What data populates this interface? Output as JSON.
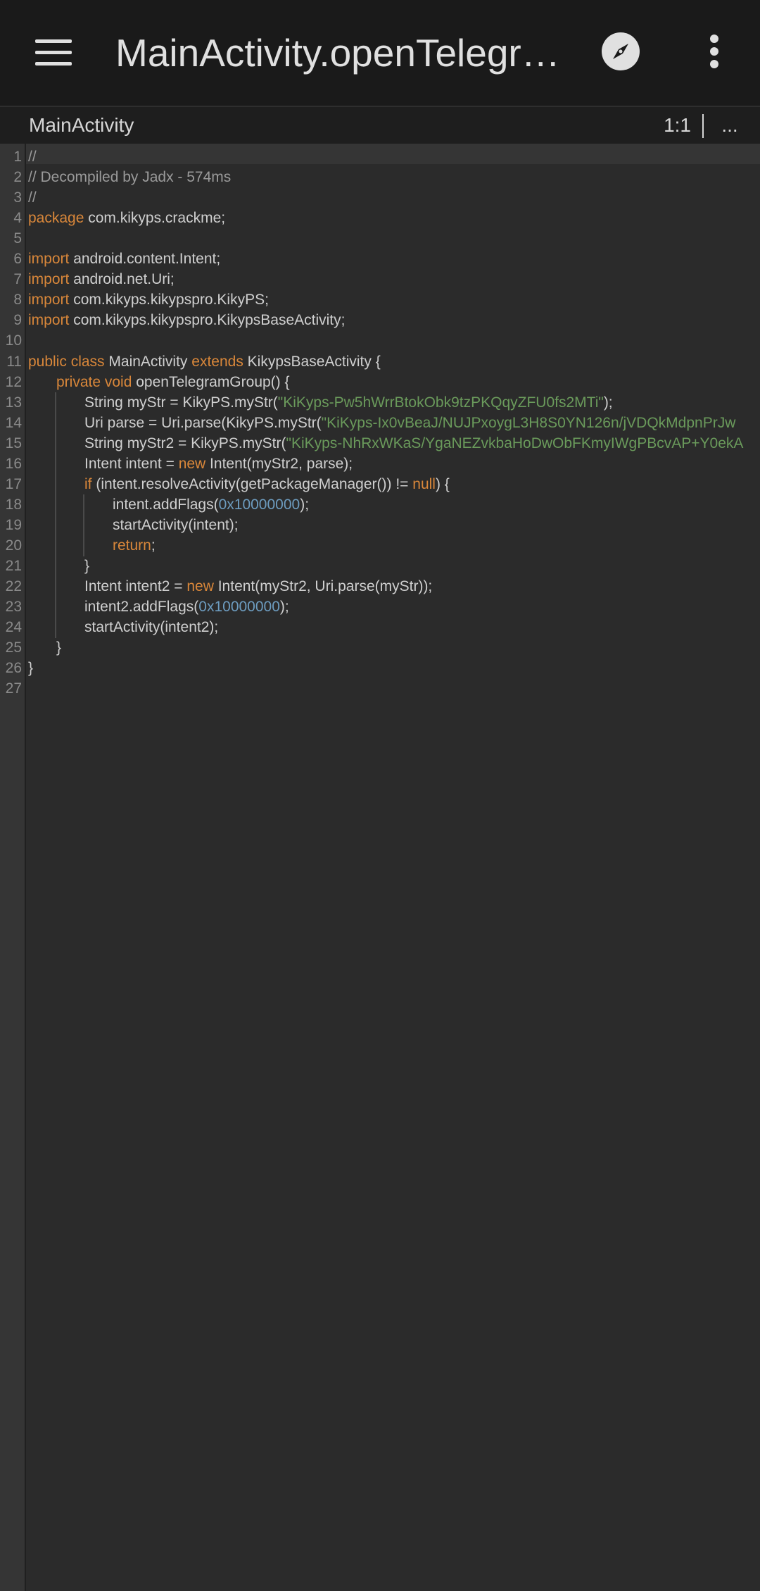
{
  "toolbar": {
    "title": "MainActivity.openTelegr…",
    "menu_icon": "hamburger-menu-icon",
    "compass_icon": "compass-icon",
    "more_icon": "more-vertical-icon"
  },
  "tab_bar": {
    "file_label": "MainActivity",
    "cursor_position": "1:1",
    "more_label": "..."
  },
  "colors": {
    "comment": "#9a9a9a",
    "keyword": "#d9873a",
    "string": "#6a9a5b",
    "number": "#6d9cbf",
    "plain": "#cfcfcf",
    "background": "#2b2b2b",
    "appbar": "#1a1a1a"
  },
  "code": {
    "lines": [
      {
        "n": "1",
        "tokens": [
          {
            "t": "//",
            "c": "comment"
          }
        ]
      },
      {
        "n": "2",
        "tokens": [
          {
            "t": "// Decompiled by Jadx - 574ms",
            "c": "comment"
          }
        ]
      },
      {
        "n": "3",
        "tokens": [
          {
            "t": "//",
            "c": "comment"
          }
        ]
      },
      {
        "n": "4",
        "tokens": [
          {
            "t": "package",
            "c": "keyword"
          },
          {
            "t": " com.kikyps.crackme;",
            "c": "plain"
          }
        ]
      },
      {
        "n": "5",
        "tokens": []
      },
      {
        "n": "6",
        "tokens": [
          {
            "t": "import",
            "c": "keyword"
          },
          {
            "t": " android.content.Intent;",
            "c": "plain"
          }
        ]
      },
      {
        "n": "7",
        "tokens": [
          {
            "t": "import",
            "c": "keyword"
          },
          {
            "t": " android.net.Uri;",
            "c": "plain"
          }
        ]
      },
      {
        "n": "8",
        "tokens": [
          {
            "t": "import",
            "c": "keyword"
          },
          {
            "t": " com.kikyps.kikypspro.KikyPS;",
            "c": "plain"
          }
        ]
      },
      {
        "n": "9",
        "tokens": [
          {
            "t": "import",
            "c": "keyword"
          },
          {
            "t": " com.kikyps.kikypspro.KikypsBaseActivity;",
            "c": "plain"
          }
        ]
      },
      {
        "n": "10",
        "tokens": []
      },
      {
        "n": "11",
        "tokens": [
          {
            "t": "public class",
            "c": "keyword"
          },
          {
            "t": " MainActivity ",
            "c": "plain"
          },
          {
            "t": "extends",
            "c": "keyword"
          },
          {
            "t": " KikypsBaseActivity {",
            "c": "plain"
          }
        ]
      },
      {
        "n": "12",
        "indent": 1,
        "tokens": [
          {
            "t": "private void",
            "c": "keyword"
          },
          {
            "t": " openTelegramGroup() {",
            "c": "plain"
          }
        ]
      },
      {
        "n": "13",
        "indent": 2,
        "tokens": [
          {
            "t": "String myStr = KikyPS.myStr(",
            "c": "plain"
          },
          {
            "t": "\"KiKyps-Pw5hWrrBtokObk9tzPKQqyZFU0fs2MTi\"",
            "c": "string"
          },
          {
            "t": ");",
            "c": "plain"
          }
        ]
      },
      {
        "n": "14",
        "indent": 2,
        "tokens": [
          {
            "t": "Uri parse = Uri.parse(KikyPS.myStr(",
            "c": "plain"
          },
          {
            "t": "\"KiKyps-Ix0vBeaJ/NUJPxoygL3H8S0YN126n/jVDQkMdpnPrJw",
            "c": "string"
          }
        ]
      },
      {
        "n": "15",
        "indent": 2,
        "tokens": [
          {
            "t": "String myStr2 = KikyPS.myStr(",
            "c": "plain"
          },
          {
            "t": "\"KiKyps-NhRxWKaS/YgaNEZvkbaHoDwObFKmyIWgPBcvAP+Y0ekA",
            "c": "string"
          }
        ]
      },
      {
        "n": "16",
        "indent": 2,
        "tokens": [
          {
            "t": "Intent intent = ",
            "c": "plain"
          },
          {
            "t": "new",
            "c": "keyword"
          },
          {
            "t": " Intent(myStr2, parse);",
            "c": "plain"
          }
        ]
      },
      {
        "n": "17",
        "indent": 2,
        "tokens": [
          {
            "t": "if",
            "c": "keyword"
          },
          {
            "t": " (intent.resolveActivity(getPackageManager()) != ",
            "c": "plain"
          },
          {
            "t": "null",
            "c": "keyword"
          },
          {
            "t": ") {",
            "c": "plain"
          }
        ]
      },
      {
        "n": "18",
        "indent": 3,
        "tokens": [
          {
            "t": "intent.addFlags(",
            "c": "plain"
          },
          {
            "t": "0x10000000",
            "c": "number"
          },
          {
            "t": ");",
            "c": "plain"
          }
        ]
      },
      {
        "n": "19",
        "indent": 3,
        "tokens": [
          {
            "t": "startActivity(intent);",
            "c": "plain"
          }
        ]
      },
      {
        "n": "20",
        "indent": 3,
        "tokens": [
          {
            "t": "return",
            "c": "keyword"
          },
          {
            "t": ";",
            "c": "plain"
          }
        ]
      },
      {
        "n": "21",
        "indent": 2,
        "tokens": [
          {
            "t": "}",
            "c": "plain"
          }
        ]
      },
      {
        "n": "22",
        "indent": 2,
        "tokens": [
          {
            "t": "Intent intent2 = ",
            "c": "plain"
          },
          {
            "t": "new",
            "c": "keyword"
          },
          {
            "t": " Intent(myStr2, Uri.parse(myStr));",
            "c": "plain"
          }
        ]
      },
      {
        "n": "23",
        "indent": 2,
        "tokens": [
          {
            "t": "intent2.addFlags(",
            "c": "plain"
          },
          {
            "t": "0x10000000",
            "c": "number"
          },
          {
            "t": ");",
            "c": "plain"
          }
        ]
      },
      {
        "n": "24",
        "indent": 2,
        "tokens": [
          {
            "t": "startActivity(intent2);",
            "c": "plain"
          }
        ]
      },
      {
        "n": "25",
        "indent": 1,
        "tokens": [
          {
            "t": "}",
            "c": "plain"
          }
        ]
      },
      {
        "n": "26",
        "tokens": [
          {
            "t": "}",
            "c": "plain"
          }
        ]
      },
      {
        "n": "27",
        "tokens": []
      }
    ]
  }
}
